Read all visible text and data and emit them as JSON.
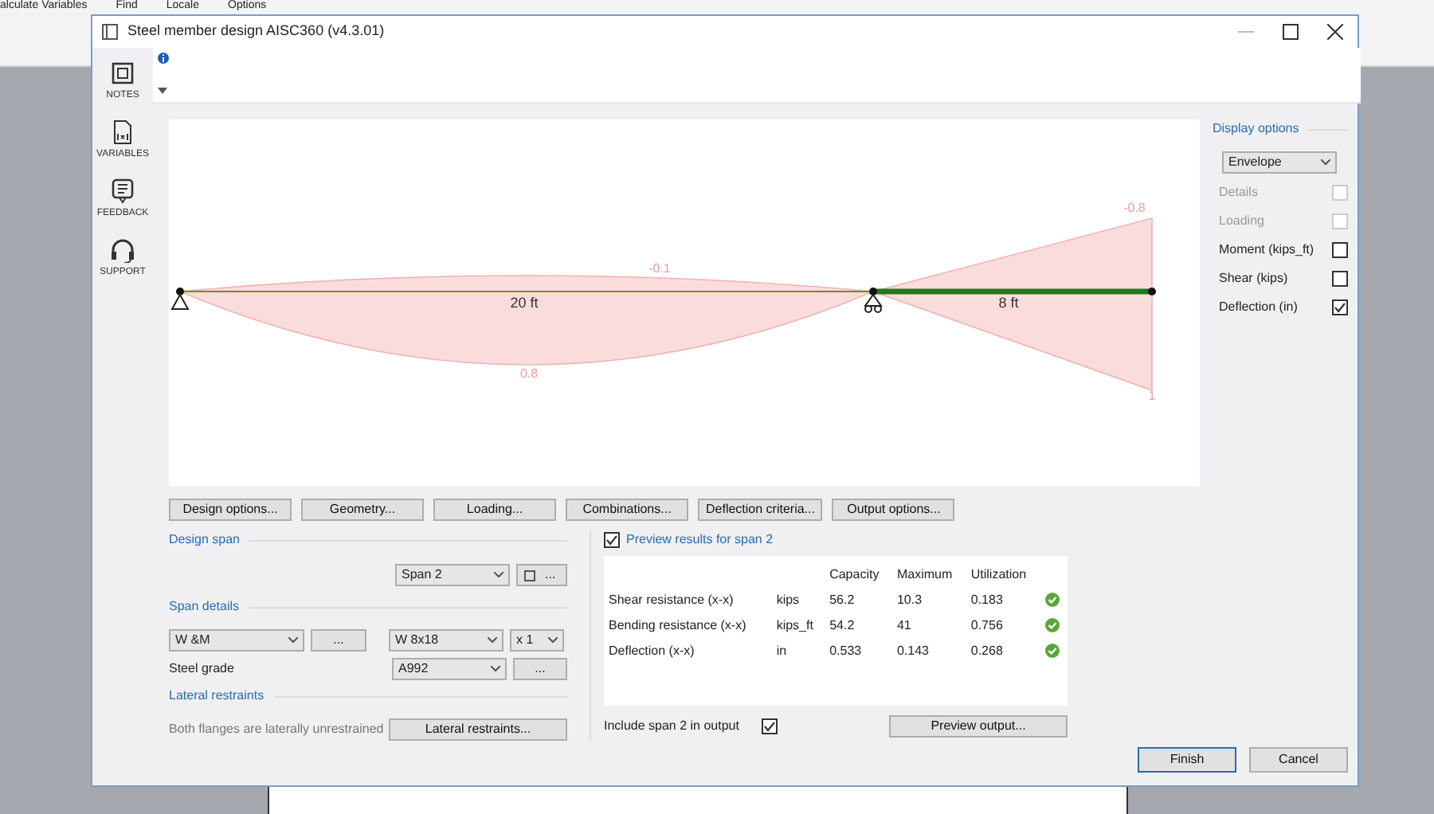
{
  "background_menu": [
    "alculate Variables",
    "Find",
    "Locale",
    "Options"
  ],
  "window": {
    "title": "Steel member design AISC360 (v4.3.01)"
  },
  "side_rail": [
    {
      "kind": "notes",
      "label": "NOTES"
    },
    {
      "kind": "variables",
      "label": "VARIABLES"
    },
    {
      "kind": "feedback",
      "label": "FEEDBACK"
    },
    {
      "kind": "support",
      "label": "SUPPORT"
    }
  ],
  "diagram": {
    "labels": [
      {
        "kind": "span",
        "text": "20 ft"
      },
      {
        "kind": "span",
        "text": "8 ft"
      },
      {
        "kind": "value",
        "text": "-0.1"
      },
      {
        "kind": "value",
        "text": "0.8"
      },
      {
        "kind": "value",
        "text": "-0.8"
      },
      {
        "kind": "value",
        "text": "1"
      }
    ]
  },
  "design_buttons": [
    "Design options...",
    "Geometry...",
    "Loading...",
    "Combinations...",
    "Deflection criteria...",
    "Output options..."
  ],
  "design_span": {
    "heading": "Design span",
    "span": "Span 2",
    "more_button": "..."
  },
  "span_details": {
    "heading": "Span details",
    "section_type": "W &M",
    "section_more_button": "...",
    "section": "W 8x18",
    "multiplier": "x 1",
    "grade_label": "Steel grade",
    "grade": "A992",
    "grade_more_button": "..."
  },
  "lateral_restraints": {
    "heading": "Lateral restraints",
    "text": "Both flanges are laterally unrestrained",
    "button": "Lateral restraints..."
  },
  "preview": {
    "label": "Preview results for span 2",
    "checked": true,
    "columns": [
      "Capacity",
      "Maximum",
      "Utilization"
    ],
    "rows": [
      {
        "name": "Shear resistance (x-x)",
        "unit": "kips",
        "capacity": "56.2",
        "maximum": "10.3",
        "utilization": "0.183",
        "ok": true
      },
      {
        "name": "Bending resistance (x-x)",
        "unit": "kips_ft",
        "capacity": "54.2",
        "maximum": "41",
        "utilization": "0.756",
        "ok": true
      },
      {
        "name": "Deflection (x-x)",
        "unit": "in",
        "capacity": "0.533",
        "maximum": "0.143",
        "utilization": "0.268",
        "ok": true
      }
    ],
    "include_label": "Include span 2 in output",
    "include_checked": true,
    "button": "Preview output..."
  },
  "display_options": {
    "heading": "Display options",
    "mode": "Envelope",
    "items": [
      {
        "label": "Details",
        "checked": false,
        "disabled": true
      },
      {
        "label": "Loading",
        "checked": false,
        "disabled": true
      },
      {
        "label": "Moment (kips_ft)",
        "checked": false,
        "disabled": false
      },
      {
        "label": "Shear (kips)",
        "checked": false,
        "disabled": false
      },
      {
        "label": "Deflection (in)",
        "checked": true,
        "disabled": false
      }
    ]
  },
  "footer_buttons": [
    {
      "label": "Finish",
      "default": true
    },
    {
      "label": "Cancel",
      "default": false
    }
  ]
}
